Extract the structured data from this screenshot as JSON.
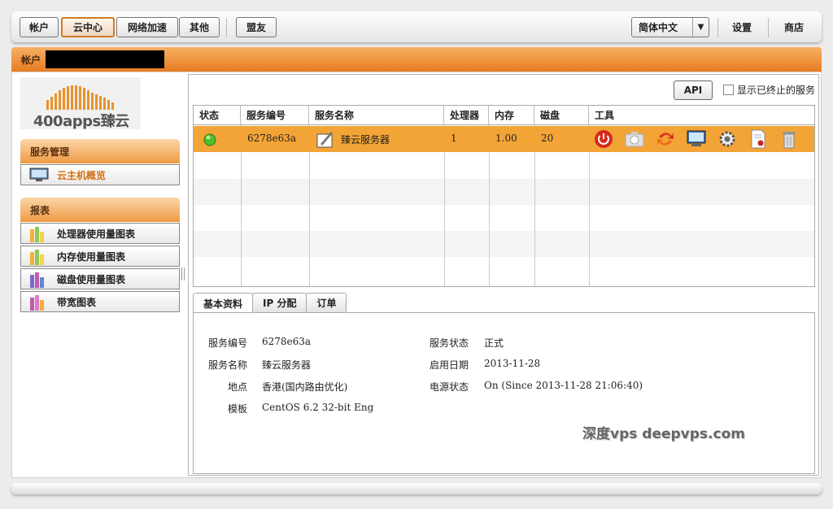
{
  "topnav": {
    "tabs": [
      {
        "label": "帐户"
      },
      {
        "label": "云中心"
      },
      {
        "label": "网络加速"
      },
      {
        "label": "其他"
      }
    ],
    "alliance": "盟友",
    "language": "简体中文",
    "settings": "设置",
    "store": "商店"
  },
  "account_bar": {
    "label": "帐户"
  },
  "logo": {
    "text": "400apps臻云"
  },
  "sidebar": {
    "section1": {
      "title": "服务管理",
      "items": [
        {
          "label": "云主机概览"
        }
      ]
    },
    "section2": {
      "title": "报表",
      "items": [
        {
          "label": "处理器使用量图表"
        },
        {
          "label": "内存使用量图表"
        },
        {
          "label": "磁盘使用量图表"
        },
        {
          "label": "带宽图表"
        }
      ]
    }
  },
  "toolbar": {
    "api_label": "API",
    "show_terminated": "显示已终止的服务"
  },
  "grid": {
    "headers": [
      "状态",
      "服务编号",
      "服务名称",
      "处理器",
      "内存",
      "磁盘",
      "工具"
    ],
    "rows": [
      {
        "status": "online",
        "id": "6278e63a",
        "name": "臻云服务器",
        "cpu": "1",
        "memory": "1.00",
        "disk": "20"
      }
    ],
    "tools": [
      "power-icon",
      "snapshot-icon",
      "refresh-icon",
      "console-icon",
      "settings-icon",
      "certificate-icon",
      "trash-icon"
    ]
  },
  "tabs": [
    {
      "label": "基本资料"
    },
    {
      "label": "IP 分配"
    },
    {
      "label": "订单"
    }
  ],
  "details": {
    "service_id_label": "服务编号",
    "service_id": "6278e63a",
    "service_name_label": "服务名称",
    "service_name": "臻云服务器",
    "location_label": "地点",
    "location": "香港(国内路由优化)",
    "template_label": "模板",
    "template": "CentOS 6.2 32-bit Eng",
    "status_label": "服务状态",
    "status": "正式",
    "start_label": "启用日期",
    "start": "2013-11-28",
    "power_label": "电源状态",
    "power": "On (Since 2013-11-28 21:06:40)"
  },
  "watermark": "深度vps  deepvps.com",
  "colors": {
    "accent": "#e77c20",
    "selected_row": "#f3a436"
  }
}
